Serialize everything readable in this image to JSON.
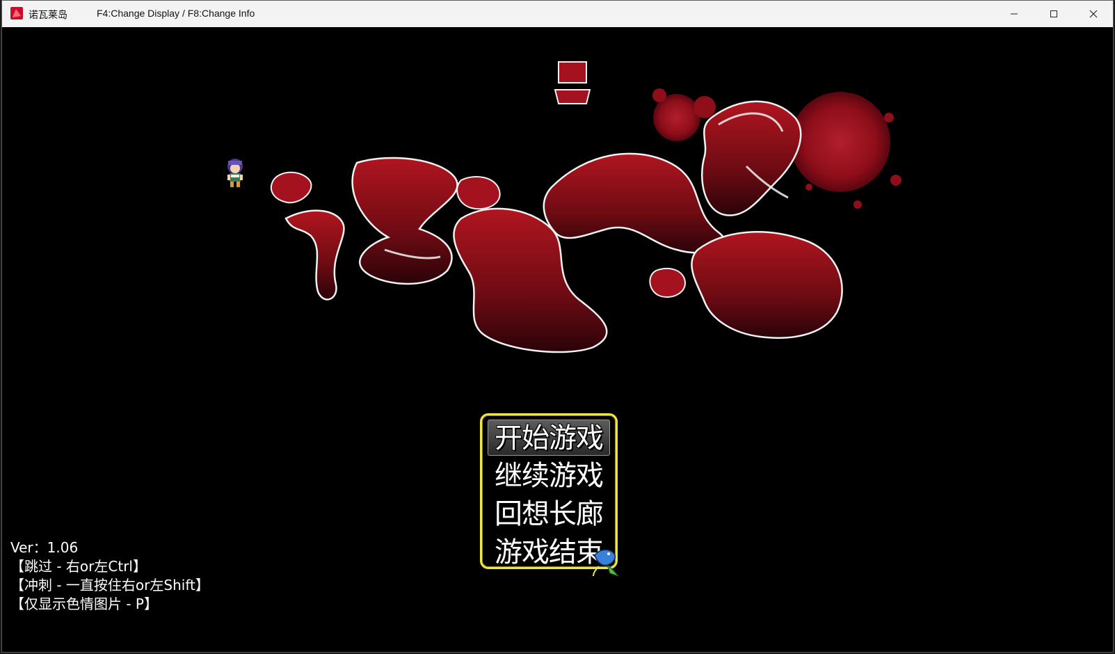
{
  "window": {
    "app_title": "诺瓦莱岛",
    "hotkey_hint": "F4:Change Display / F8:Change Info"
  },
  "title_menu": {
    "items": [
      {
        "label": "开始游戏",
        "selected": true
      },
      {
        "label": "继续游戏",
        "selected": false
      },
      {
        "label": "回想长廊",
        "selected": false
      },
      {
        "label": "游戏结束",
        "selected": false
      }
    ]
  },
  "info": {
    "version": "Ver：1.06",
    "hints": [
      "【跳过 - 右or左Ctrl】",
      "【冲刺 - 一直按住右or左Shift】",
      "【仅显示色情图片 - P】"
    ]
  },
  "colors": {
    "menu_border": "#f0e44a",
    "logo_red": "#8e0e1a",
    "background": "#000000"
  },
  "icons": [
    "app-icon",
    "minimize-icon",
    "maximize-icon",
    "close-icon",
    "player-sprite-icon",
    "blue-bird-cursor-icon"
  ]
}
